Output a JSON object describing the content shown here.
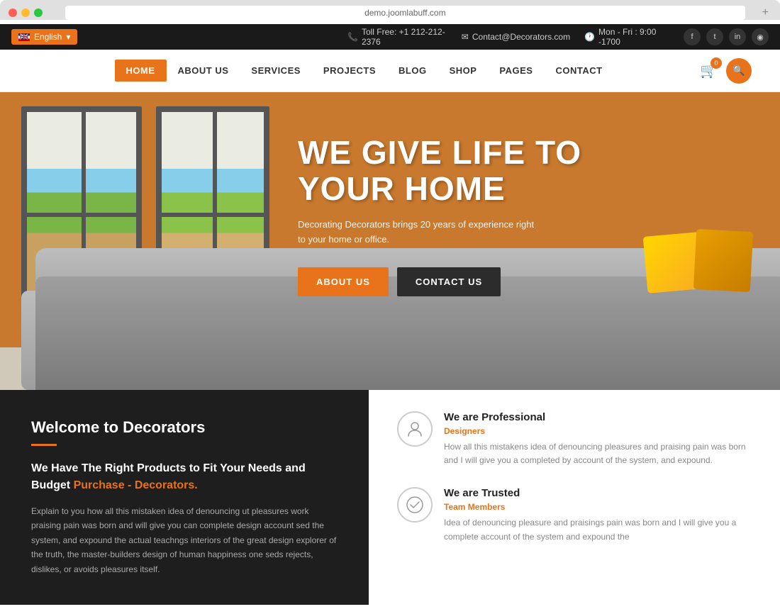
{
  "browser": {
    "url": "demo.joomlabuff.com",
    "add_tab_label": "+"
  },
  "topbar": {
    "lang_label": "English",
    "phone_icon": "📞",
    "phone": "Toll Free: +1 212-212-2376",
    "email_icon": "✉",
    "email": "Contact@Decorators.com",
    "hours_icon": "🕐",
    "hours": "Mon - Fri : 9:00 -1700",
    "social": {
      "facebook": "f",
      "twitter": "t",
      "linkedin": "in",
      "instagram": "◉"
    }
  },
  "nav": {
    "items": [
      {
        "label": "HOME",
        "active": true
      },
      {
        "label": "ABOUT US",
        "active": false
      },
      {
        "label": "SERVICES",
        "active": false
      },
      {
        "label": "PROJECTS",
        "active": false
      },
      {
        "label": "BLOG",
        "active": false
      },
      {
        "label": "SHOP",
        "active": false
      },
      {
        "label": "PAGES",
        "active": false
      },
      {
        "label": "CONTACT",
        "active": false
      }
    ],
    "cart_count": "0",
    "search_icon": "🔍"
  },
  "hero": {
    "title_line1": "WE GIVE LIFE TO",
    "title_line2": "YOUR HOME",
    "subtitle": "Decorating Decorators brings 20 years of experience right to your home or office.",
    "btn_about": "ABOUT US",
    "btn_contact": "CONTACT US"
  },
  "bottom": {
    "left": {
      "title": "Welcome to Decorators",
      "subtitle_normal": "We Have The Right Products to Fit Your Needs and Budget",
      "subtitle_orange": "Purchase - Decorators.",
      "body": "Explain to you how all this mistaken idea of denouncing ut pleasures work praising pain was born and will give you can complete design account sed the system, and expound the actual teachngs interiors of the great design explorer of the truth, the master-builders design of human happiness one seds rejects, dislikes, or avoids pleasures itself."
    },
    "right": {
      "features": [
        {
          "icon": "👤",
          "title": "We are Professional",
          "subtitle": "Designers",
          "body": "How all this mistakens idea of denouncing pleasures and praising pain was born and I will give you a completed by account of the system, and expound."
        },
        {
          "icon": "✓",
          "title": "We are Trusted",
          "subtitle": "Team Members",
          "body": "Idea of denouncing pleasure and praisings pain was born and I will give you a complete account of the system and expound the"
        }
      ]
    }
  }
}
